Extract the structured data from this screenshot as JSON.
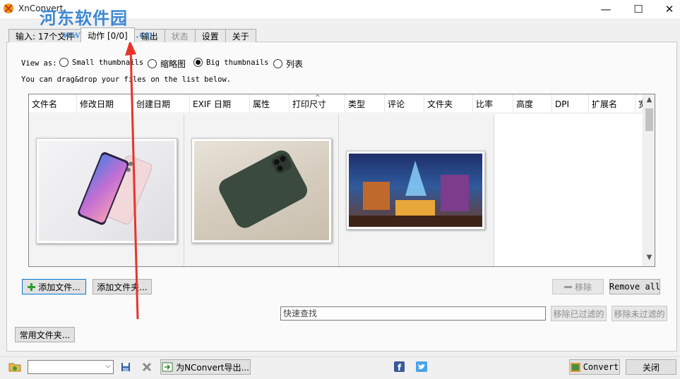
{
  "window": {
    "title": "XnConvert",
    "minimize_glyph": "—",
    "maximize_glyph": "☐",
    "close_glyph": "✕"
  },
  "watermark": {
    "text": "河东软件园",
    "url": "www.pc0359.cn"
  },
  "tabs": [
    {
      "label": "输入: 17个文件",
      "state": "normal"
    },
    {
      "label": "动作 [0/0]",
      "state": "active"
    },
    {
      "label": "输出",
      "state": "normal"
    },
    {
      "label": "状态",
      "state": "disabled"
    },
    {
      "label": "设置",
      "state": "normal"
    },
    {
      "label": "关于",
      "state": "normal"
    }
  ],
  "view": {
    "label": "View as:",
    "options": [
      {
        "label": "Small thumbnails",
        "checked": false
      },
      {
        "label": "缩略图",
        "checked": false
      },
      {
        "label": "Big thumbnails",
        "checked": true
      },
      {
        "label": "列表",
        "checked": false
      }
    ],
    "hint": "You can drag&drop your files on the list below."
  },
  "file_list": {
    "columns": [
      "文件名",
      "修改日期",
      "创建日期",
      "EXIF 日期",
      "属性",
      "打印尺寸",
      "类型",
      "评论",
      "文件夹",
      "比率",
      "高度",
      "DPI",
      "扩展名",
      "宽"
    ],
    "sort_indicator": "^",
    "thumbnails": [
      {
        "subject": "smartphone-pink-gradient"
      },
      {
        "subject": "smartphone-dark-green-back"
      },
      {
        "subject": "game-artwork"
      }
    ],
    "scroll_up": "▲",
    "scroll_down": "▼"
  },
  "buttons": {
    "add_files": "添加文件...",
    "add_folder": "添加文件夹...",
    "remove": "移除",
    "remove_all": "Remove all",
    "remove_filtered": "移除已过滤的",
    "remove_unfiltered": "移除未过滤的",
    "common_folders": "常用文件夹..."
  },
  "search": {
    "placeholder": "快速查找"
  },
  "bottom": {
    "preset_value": "",
    "export_label": "为NConvert导出...",
    "convert_label": "Convert",
    "close_label": "关闭"
  },
  "colors": {
    "accent_blue": "#0078d7",
    "watermark_blue": "#2e7fd0",
    "annotation_red": "#e8332b"
  }
}
